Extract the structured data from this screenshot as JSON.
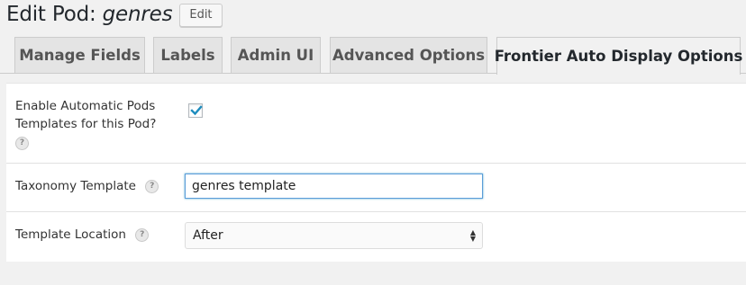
{
  "header": {
    "title_prefix": "Edit Pod: ",
    "pod_name": "genres",
    "edit_label": "Edit"
  },
  "tabs": [
    {
      "label": "Manage Fields",
      "active": false
    },
    {
      "label": "Labels",
      "active": false
    },
    {
      "label": "Admin UI",
      "active": false
    },
    {
      "label": "Advanced Options",
      "active": false
    },
    {
      "label": "Frontier Auto Display Options",
      "active": true
    }
  ],
  "fields": {
    "enable_templates": {
      "label": "Enable Automatic Pods Templates for this Pod?",
      "checked": true,
      "help_icon": "?"
    },
    "taxonomy_template": {
      "label": "Taxonomy Template",
      "help_icon": "?",
      "value": "genres template"
    },
    "template_location": {
      "label": "Template Location",
      "help_icon": "?",
      "value": "After"
    }
  },
  "colors": {
    "page_bg": "#f1f1f1",
    "panel_bg": "#ffffff",
    "tab_bg": "#e4e4e4",
    "focus_border": "#5b9dd9",
    "check_color": "#1e8cbe"
  }
}
